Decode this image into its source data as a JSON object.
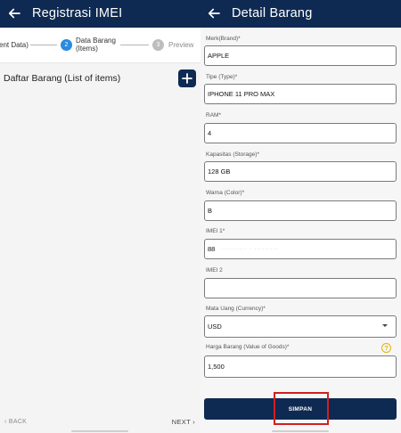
{
  "left": {
    "appbar": {
      "title": "Registrasi IMEI"
    },
    "stepper": {
      "steps": [
        {
          "label": "ent Data)"
        },
        {
          "number": "2",
          "label": "Data Barang",
          "sublabel": "(Items)"
        },
        {
          "number": "3",
          "label": "Preview"
        }
      ],
      "active_color": "#2a8be0",
      "inactive_color": "#bdbdbd"
    },
    "list_title": "Daftar Barang (List of items)",
    "add_label": "+",
    "footer": {
      "back_label": "‹  BACK",
      "next_label": "NEXT  ›"
    }
  },
  "right": {
    "appbar": {
      "title": "Detail Barang"
    },
    "fields": {
      "brand": {
        "label": "Merk(Brand)*",
        "value": "APPLE"
      },
      "type": {
        "label": "Tipe (Type)*",
        "value": "IPHONE 11 PRO MAX"
      },
      "ram": {
        "label": "RAM*",
        "value": "4"
      },
      "storage": {
        "label": "Kapasitas (Storage)*",
        "value": "128 GB"
      },
      "color": {
        "label": "Warna (Color)*",
        "value": "B"
      },
      "imei1": {
        "label": "IMEI 1*",
        "value": "88"
      },
      "imei2": {
        "label": "IMEI 2",
        "value": ""
      },
      "currency": {
        "label": "Mata Uang (Currency)*",
        "value": "USD"
      },
      "goods_value": {
        "label": "Harga Barang (Value of Goods)*",
        "value": "1,500"
      }
    },
    "help_label": "?",
    "save_label": "SIMPAN"
  },
  "colors": {
    "brand_navy": "#0f2a52",
    "highlight_red": "#d11f1f",
    "help_yellow": "#e0b400"
  }
}
